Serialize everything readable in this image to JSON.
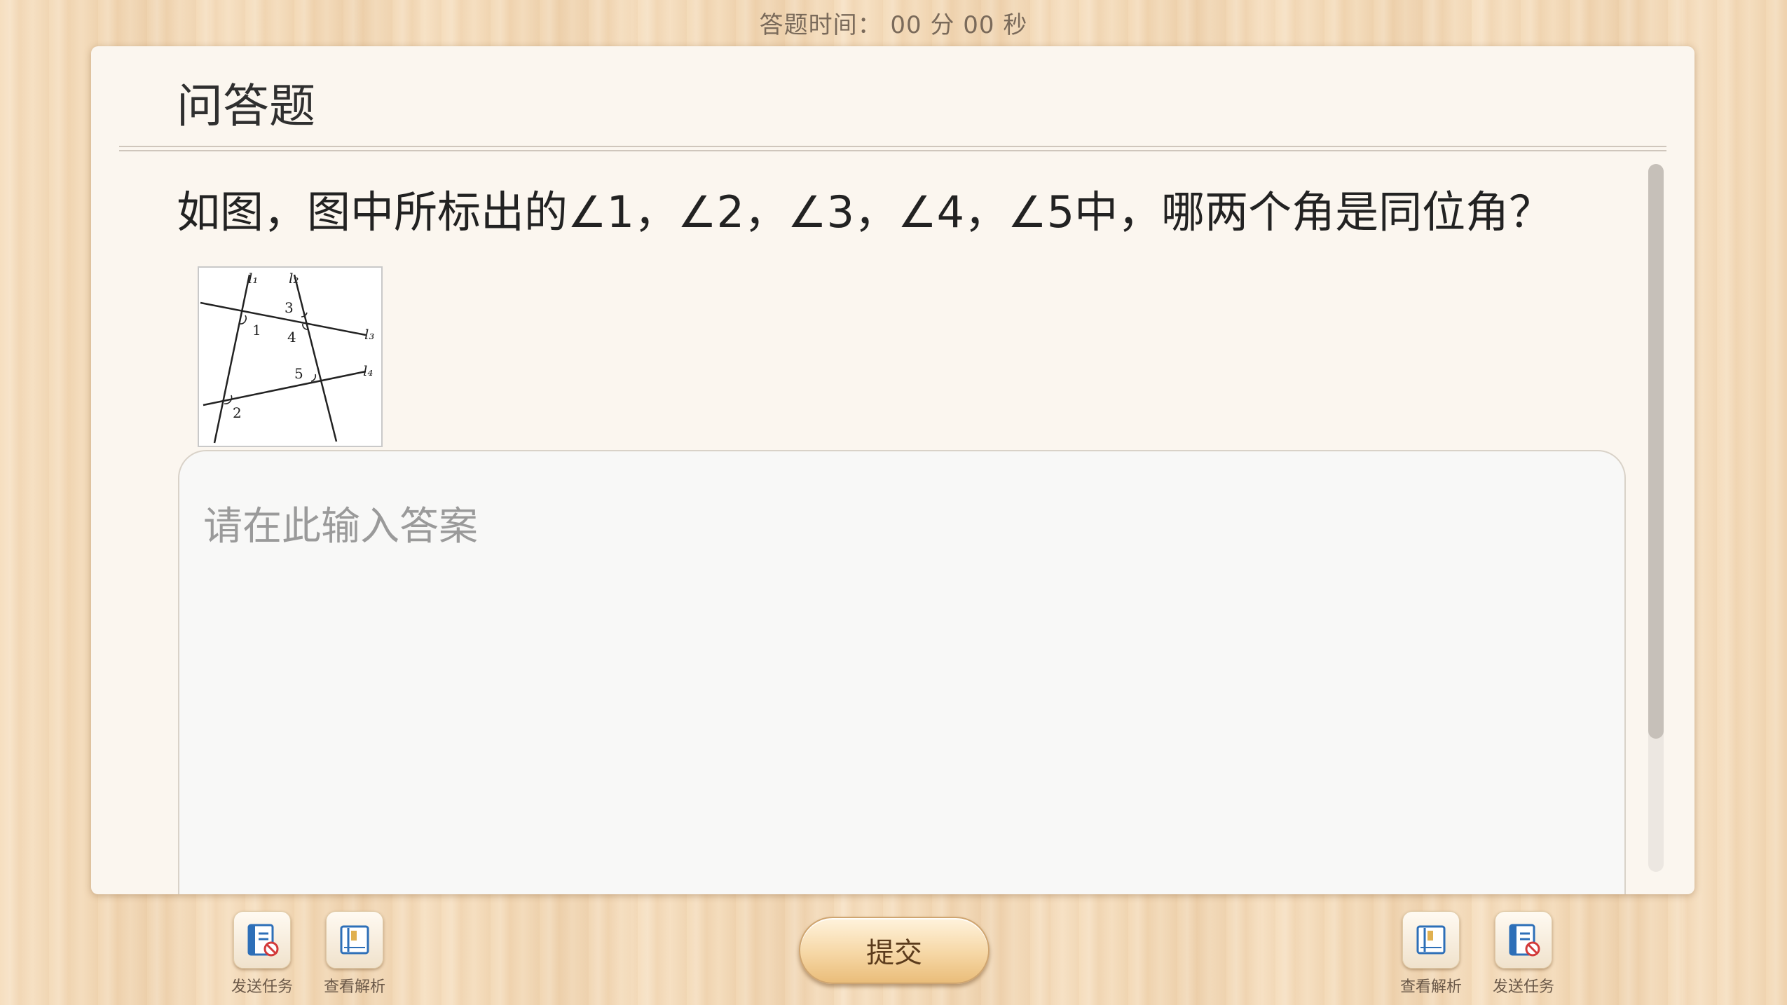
{
  "timer": {
    "text": "答题时间： 00 分 00 秒"
  },
  "card": {
    "title": "问答题",
    "question": "如图，图中所标出的∠1，∠2，∠3，∠4，∠5中，哪两个角是同位角？",
    "answer": {
      "value": "",
      "placeholder": "请在此输入答案"
    },
    "figure": {
      "line_labels": [
        "l₁",
        "l₂",
        "l₃",
        "l₄"
      ],
      "angle_labels": [
        "1",
        "2",
        "3",
        "4",
        "5"
      ]
    }
  },
  "toolbar": {
    "left": [
      {
        "label": "发送任务",
        "icon": "send-task-icon"
      },
      {
        "label": "查看解析",
        "icon": "view-analysis-icon"
      }
    ],
    "submit_label": "提交",
    "right": [
      {
        "label": "查看解析",
        "icon": "view-analysis-icon"
      },
      {
        "label": "发送任务",
        "icon": "send-task-icon"
      }
    ]
  },
  "colors": {
    "card_background": "#fbf6ef",
    "submit_button": "#f6d7a5",
    "icon_accent": "#2d6fb8",
    "icon_badge": "#d23a3a"
  }
}
